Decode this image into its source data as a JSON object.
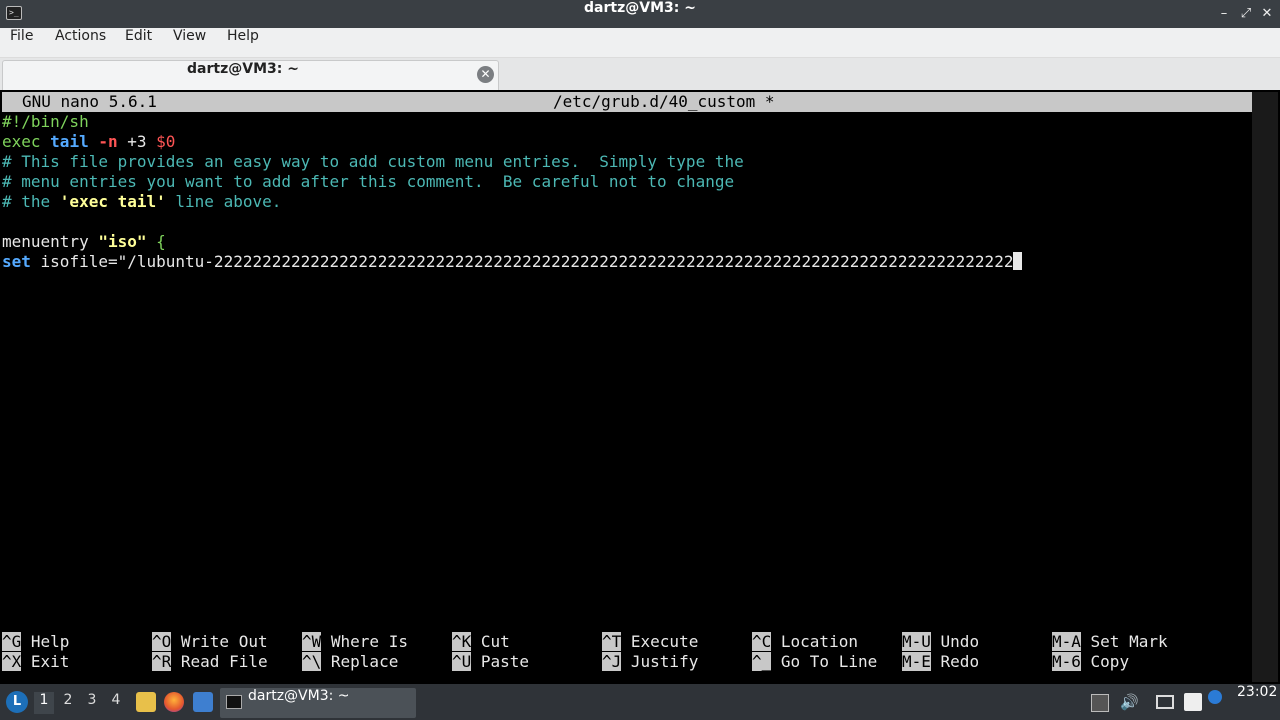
{
  "window": {
    "title": "dartz@VM3: ~",
    "controls": {
      "minimize": "–",
      "maximize": "⤢",
      "close": "✕"
    }
  },
  "menu": [
    "File",
    "Actions",
    "Edit",
    "View",
    "Help"
  ],
  "tab": {
    "title": "dartz@VM3: ~",
    "close": "✕"
  },
  "nano": {
    "version": "GNU nano 5.6.1",
    "file": "/etc/grub.d/40_custom *",
    "lines": {
      "l1": "#!/bin/sh",
      "l2": {
        "exec": "exec",
        "tail": "tail",
        "flag": "-n",
        "plus": "+3",
        "arg": "$0"
      },
      "l3": "# This file provides an easy way to add custom menu entries.  Simply type the",
      "l4": "# menu entries you want to add after this comment.  Be careful not to change",
      "l5": {
        "pre": "# the ",
        "quoted": "'exec tail'",
        "post": " line above."
      },
      "l7": {
        "kw": "menuentry ",
        "str": "\"iso\"",
        "brace": " {"
      },
      "l8": {
        "kw": "set",
        "text": " isofile=\"/lubuntu-22222222222222222222222222222222222222222222222222222222222222222222222222222222222"
      }
    },
    "shortcuts": [
      {
        "key": "^G",
        "label": " Help"
      },
      {
        "key": "^O",
        "label": " Write Out"
      },
      {
        "key": "^W",
        "label": " Where Is"
      },
      {
        "key": "^K",
        "label": " Cut"
      },
      {
        "key": "^T",
        "label": " Execute"
      },
      {
        "key": "^C",
        "label": " Location"
      },
      {
        "key": "M-U",
        "label": " Undo"
      },
      {
        "key": "M-A",
        "label": " Set Mark"
      },
      {
        "key": "^X",
        "label": " Exit"
      },
      {
        "key": "^R",
        "label": " Read File"
      },
      {
        "key": "^\\",
        "label": " Replace"
      },
      {
        "key": "^U",
        "label": " Paste"
      },
      {
        "key": "^J",
        "label": " Justify"
      },
      {
        "key": "^_",
        "label": " Go To Line"
      },
      {
        "key": "M-E",
        "label": " Redo"
      },
      {
        "key": "M-6",
        "label": " Copy"
      }
    ]
  },
  "taskbar": {
    "workspaces": [
      "1",
      "2",
      "3",
      "4"
    ],
    "active_workspace": "1",
    "task_label": "dartz@VM3: ~",
    "clock": "23:02",
    "colors": {
      "taskbar_bg": "#2f3338",
      "accent": "#1d6fb8"
    }
  }
}
